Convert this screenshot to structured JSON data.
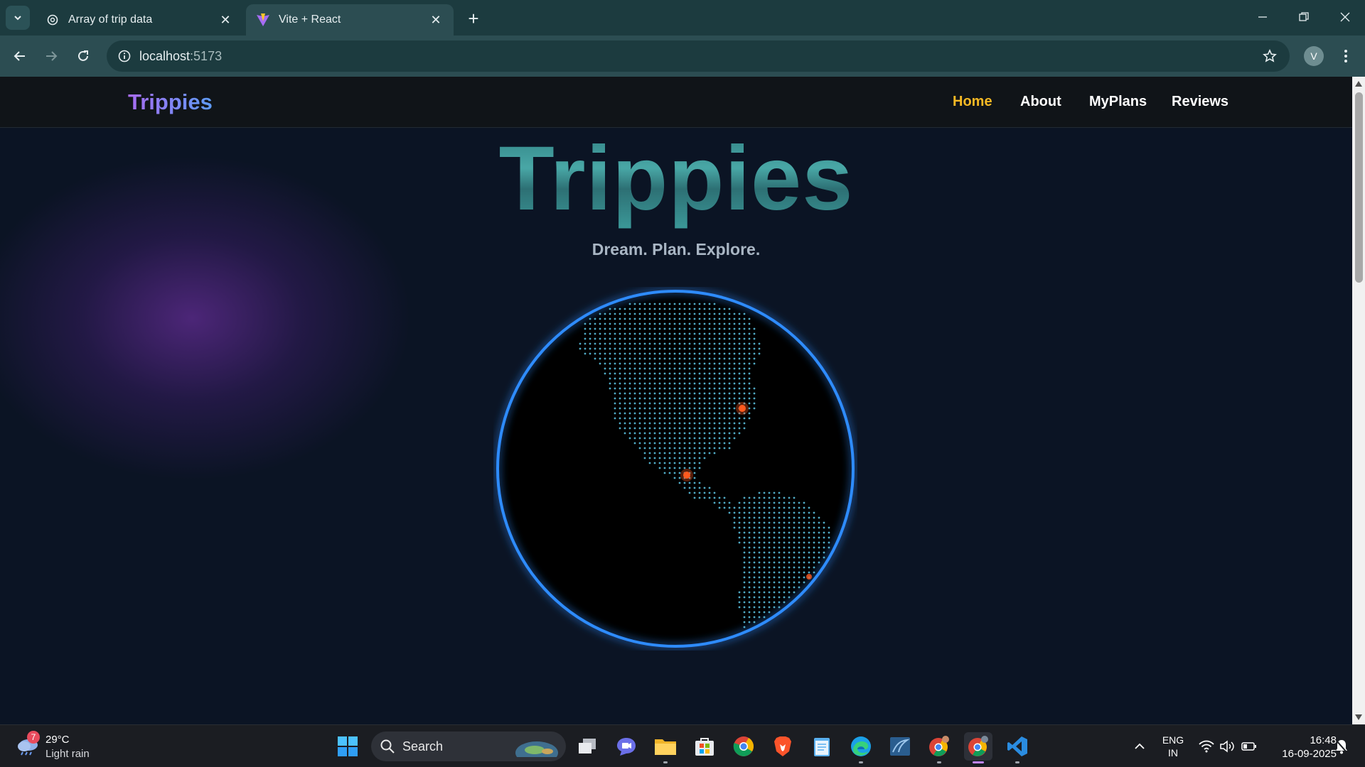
{
  "browser": {
    "tabs": [
      {
        "title": "Array of trip data",
        "active": false,
        "icon": "openai-icon"
      },
      {
        "title": "Vite + React",
        "active": true,
        "icon": "vite-icon"
      }
    ],
    "url_host": "localhost",
    "url_port": ":5173",
    "profile_initial": "V"
  },
  "page": {
    "brand": "Trippies",
    "nav": {
      "home": "Home",
      "about": "About",
      "myplans": "MyPlans",
      "reviews": "Reviews"
    },
    "hero_title": "Trippies",
    "tagline": "Dream. Plan. Explore.",
    "colors": {
      "active_nav": "#f5b924",
      "globe_ring": "#2f8cff",
      "globe_dots": "#5ec8e8",
      "marker": "#ff5a1f"
    }
  },
  "taskbar": {
    "weather": {
      "temp": "29°C",
      "condition": "Light rain",
      "badge": "7"
    },
    "search_placeholder": "Search",
    "lang_line1": "ENG",
    "lang_line2": "IN",
    "time": "16:48",
    "date": "16-09-2025",
    "apps": [
      "task-view",
      "teams-meet",
      "file-explorer",
      "microsoft-store",
      "chrome",
      "brave",
      "notepad",
      "edge",
      "vscode-like-app",
      "chrome-profile",
      "chrome-active",
      "vscode"
    ]
  }
}
